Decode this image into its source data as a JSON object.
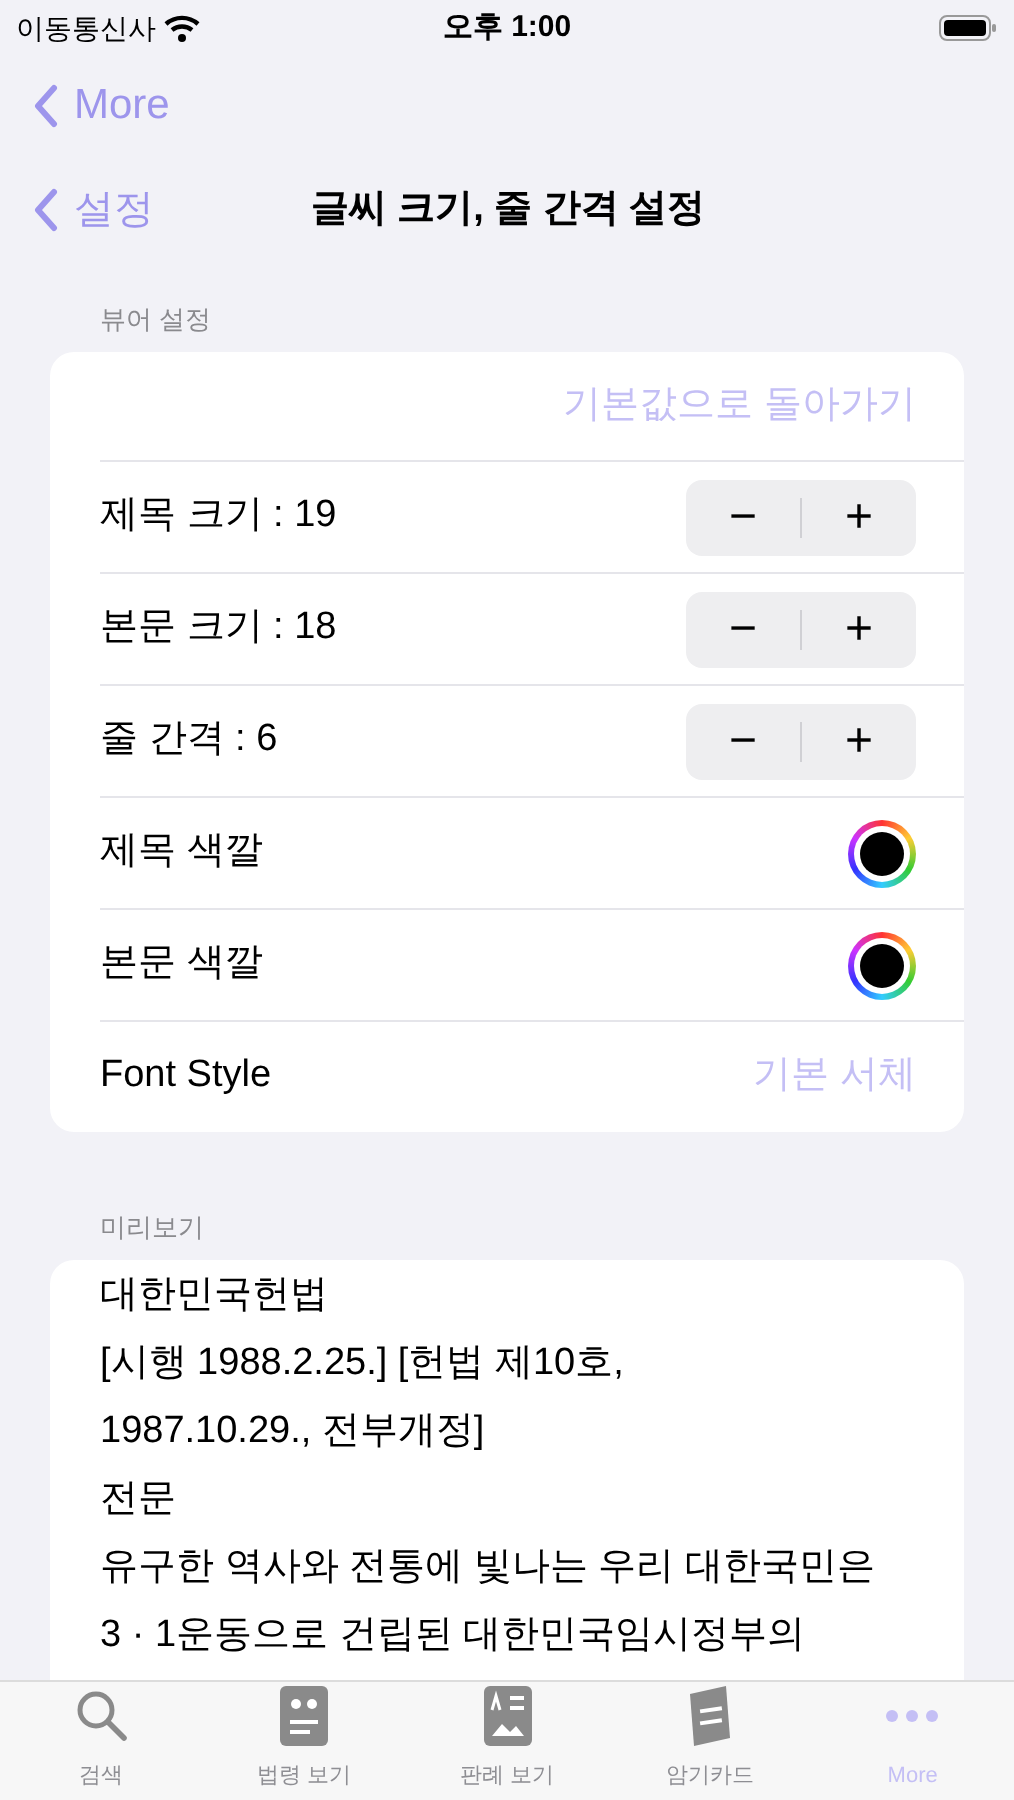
{
  "status_bar": {
    "carrier": "이동통신사",
    "time": "오후 1:00"
  },
  "nav": {
    "top_back": "More",
    "back": "설정",
    "title": "글씨 크기, 줄 간격 설정"
  },
  "viewer_section": {
    "header": "뷰어 설정",
    "rows": [
      {
        "kind": "action",
        "label": "기본값으로 돌아가기"
      },
      {
        "kind": "stepper",
        "label": "제목 크기 : 19",
        "minus": "−",
        "plus": "+"
      },
      {
        "kind": "stepper",
        "label": "본문 크기 : 18",
        "minus": "−",
        "plus": "+"
      },
      {
        "kind": "stepper",
        "label": "줄 간격 : 6",
        "minus": "−",
        "plus": "+"
      },
      {
        "kind": "color",
        "label": "제목 색깔",
        "color": "#000000"
      },
      {
        "kind": "color",
        "label": "본문 색깔",
        "color": "#000000"
      },
      {
        "kind": "value",
        "label": "Font Style",
        "value": "기본 서체"
      }
    ]
  },
  "preview_section": {
    "header": "미리보기",
    "lines": [
      "대한민국헌법",
      "[시행 1988.2.25.] [헌법 제10호,",
      "1987.10.29., 전부개정]",
      "전문",
      "유구한 역사와 전통에 빛나는 우리 대한국민은",
      "3 · 1운동으로 건립된 대한민국임시정부의"
    ]
  },
  "tab_bar": [
    {
      "kind": "search",
      "label": "검색",
      "selected": false
    },
    {
      "kind": "quote",
      "label": "법령 보기",
      "selected": false
    },
    {
      "kind": "doc",
      "label": "판례 보기",
      "selected": false
    },
    {
      "kind": "book",
      "label": "암기카드",
      "selected": false
    },
    {
      "kind": "more",
      "label": "More",
      "selected": true
    }
  ]
}
